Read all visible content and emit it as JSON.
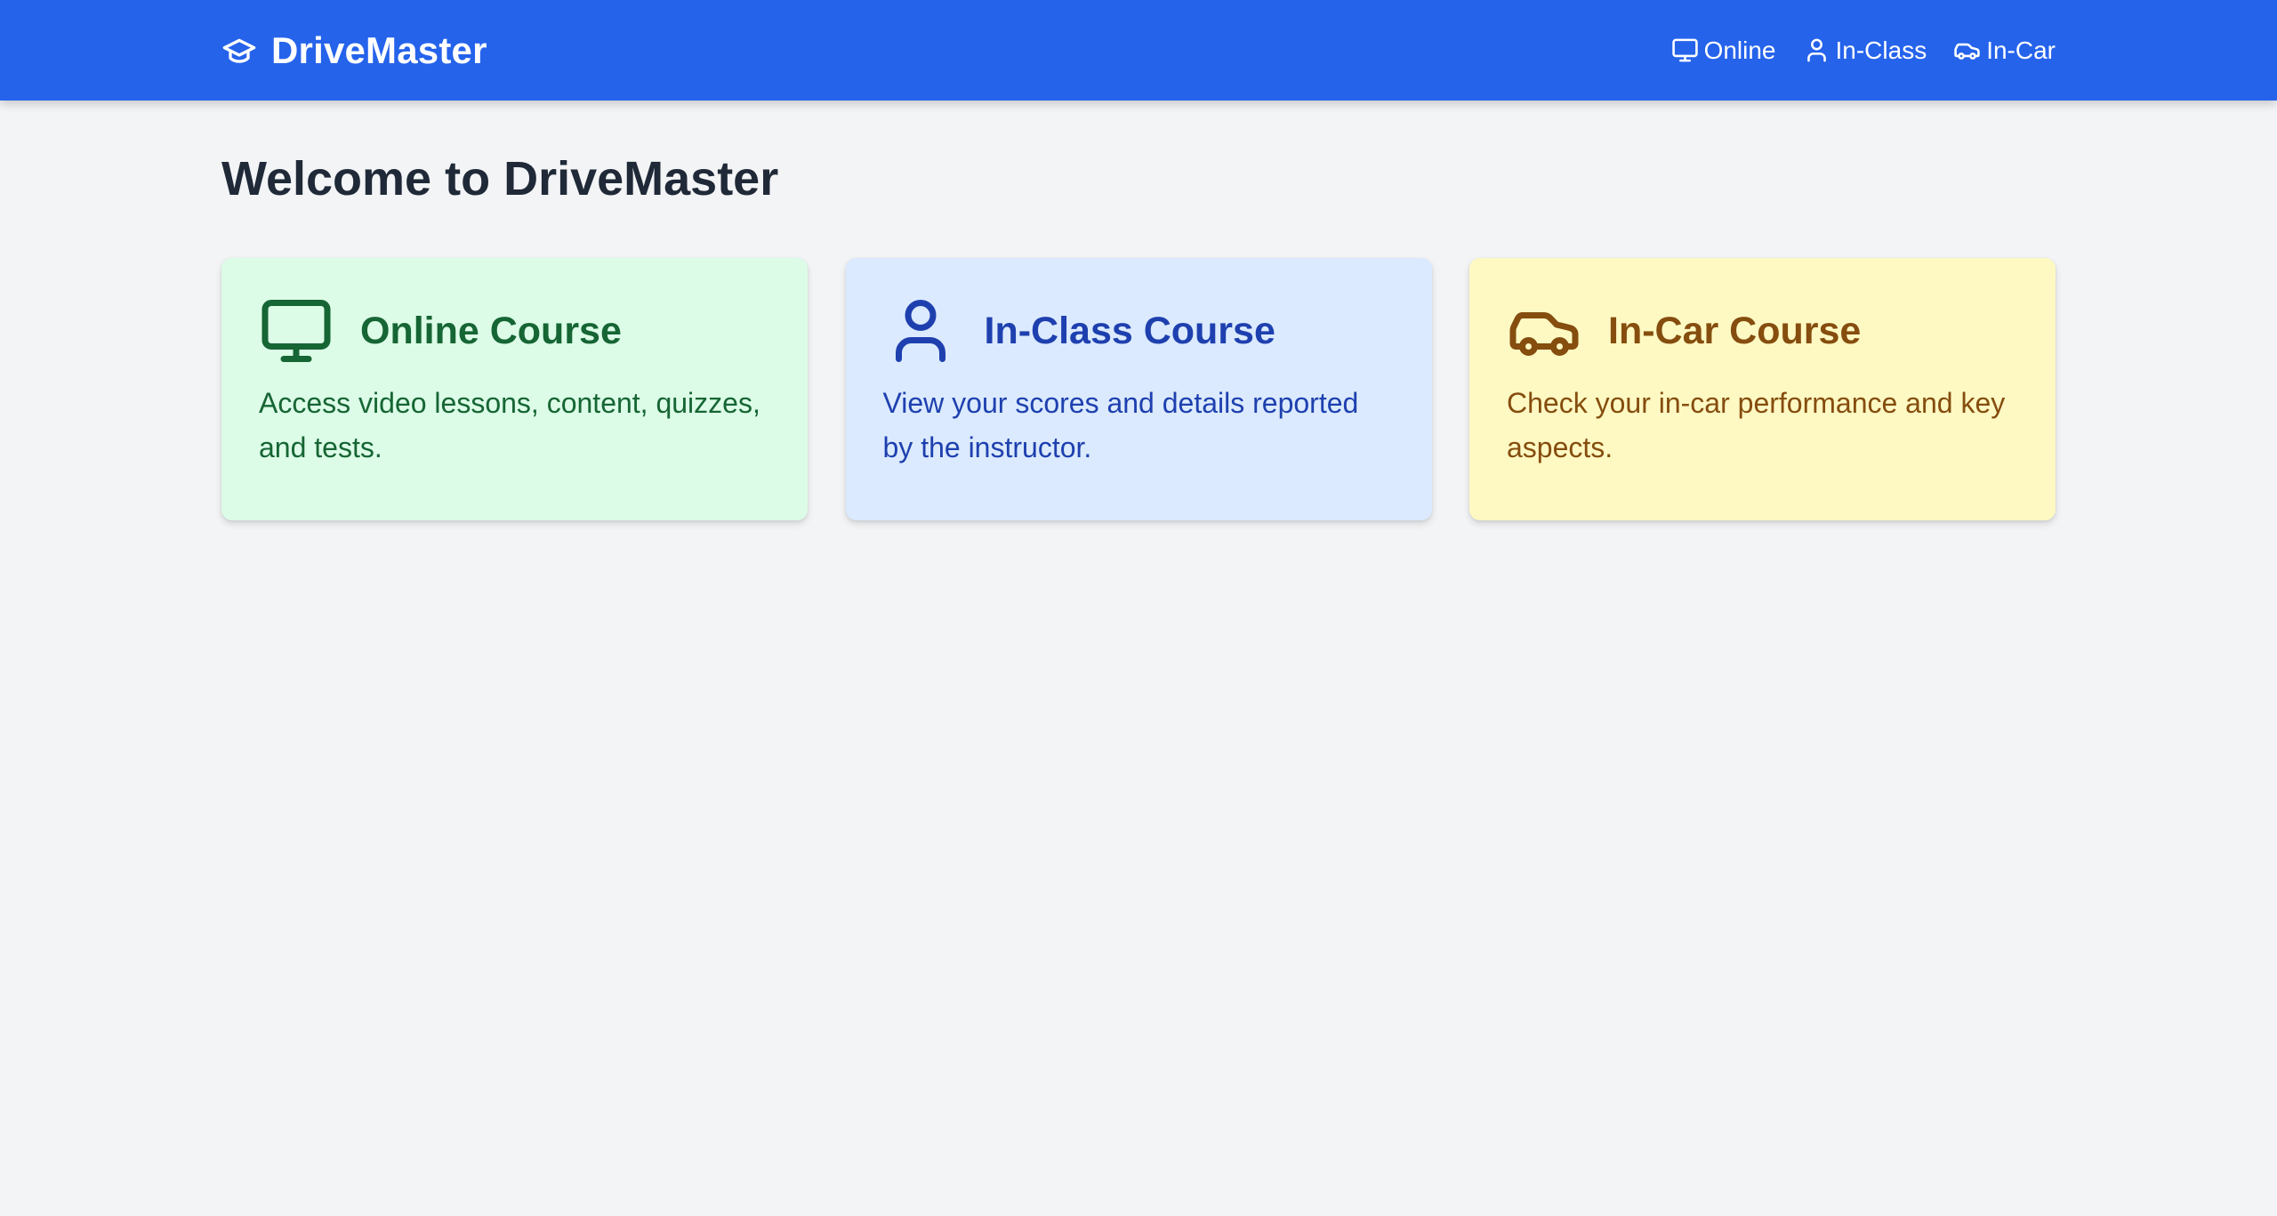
{
  "app": {
    "brand": "DriveMaster",
    "brand_icon": "graduation-cap-icon"
  },
  "nav": {
    "links": [
      {
        "label": "Online",
        "icon": "monitor-icon"
      },
      {
        "label": "In-Class",
        "icon": "user-icon"
      },
      {
        "label": "In-Car",
        "icon": "car-icon"
      }
    ]
  },
  "main": {
    "title": "Welcome to DriveMaster",
    "cards": [
      {
        "title": "Online Course",
        "description": "Access video lessons, content, quizzes, and tests.",
        "icon": "monitor-icon",
        "background": "#dcfce7",
        "color": "#166534"
      },
      {
        "title": "In-Class Course",
        "description": "View your scores and details reported by the instructor.",
        "icon": "user-icon",
        "background": "#dbeafe",
        "color": "#1e40af"
      },
      {
        "title": "In-Car Course",
        "description": "Check your in-car performance and key aspects.",
        "icon": "car-icon",
        "background": "#fef9c3",
        "color": "#854d0e"
      }
    ]
  },
  "colors": {
    "navbar": "#2563eb",
    "page_background": "#f3f4f6",
    "title": "#1f2937"
  }
}
